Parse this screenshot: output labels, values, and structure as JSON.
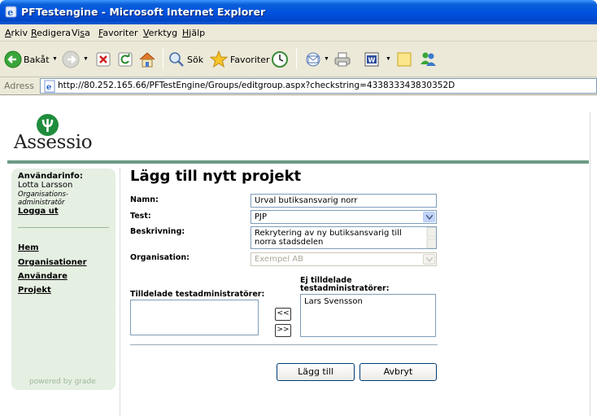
{
  "window": {
    "title": "PFTestengine - Microsoft Internet Explorer"
  },
  "menu": {
    "items": [
      {
        "pre": "",
        "u": "A",
        "post": "rkiv"
      },
      {
        "pre": "",
        "u": "R",
        "post": "edigera"
      },
      {
        "pre": "Vi",
        "u": "s",
        "post": "a"
      },
      {
        "pre": "",
        "u": "F",
        "post": "avoriter"
      },
      {
        "pre": "",
        "u": "V",
        "post": "erktyg"
      },
      {
        "pre": "",
        "u": "H",
        "post": "jälp"
      }
    ]
  },
  "toolbar": {
    "back_label": "Bakåt",
    "search_label": "Sök",
    "favorites_label": "Favoriter"
  },
  "address": {
    "label": "Adress",
    "url": "http://80.252.165.66/PFTestEngine/Groups/editgroup.aspx?checkstring=433833343830352D"
  },
  "logo": {
    "text": "Assessio"
  },
  "sidebar": {
    "userinfo_title": "Användarinfo:",
    "user_name": "Lotta Larsson",
    "role_line1": "Organisations-",
    "role_line2": "administratör",
    "logout": "Logga ut",
    "nav": [
      "Hem",
      "Organisationer",
      "Användare",
      "Projekt"
    ],
    "powered": "powered by grade"
  },
  "form": {
    "title": "Lägg till nytt projekt",
    "name_label": "Namn:",
    "name_value": "Urval butiksansvarig norr",
    "test_label": "Test:",
    "test_value": "PJP",
    "desc_label": "Beskrivning:",
    "desc_line1": "Rekrytering av ny butiksansvarig till",
    "desc_line2": "norra stadsdelen",
    "org_label": "Organisation:",
    "org_value": "Exempel AB",
    "assigned_label": "Tilldelade testadministratörer:",
    "unassigned_label_1": "Ej tilldelade",
    "unassigned_label_2": "testadministratörer:",
    "unassigned_items": [
      "Lars Svensson"
    ],
    "move_left": "<<",
    "move_right": ">>",
    "submit": "Lägg till",
    "cancel": "Avbryt"
  }
}
